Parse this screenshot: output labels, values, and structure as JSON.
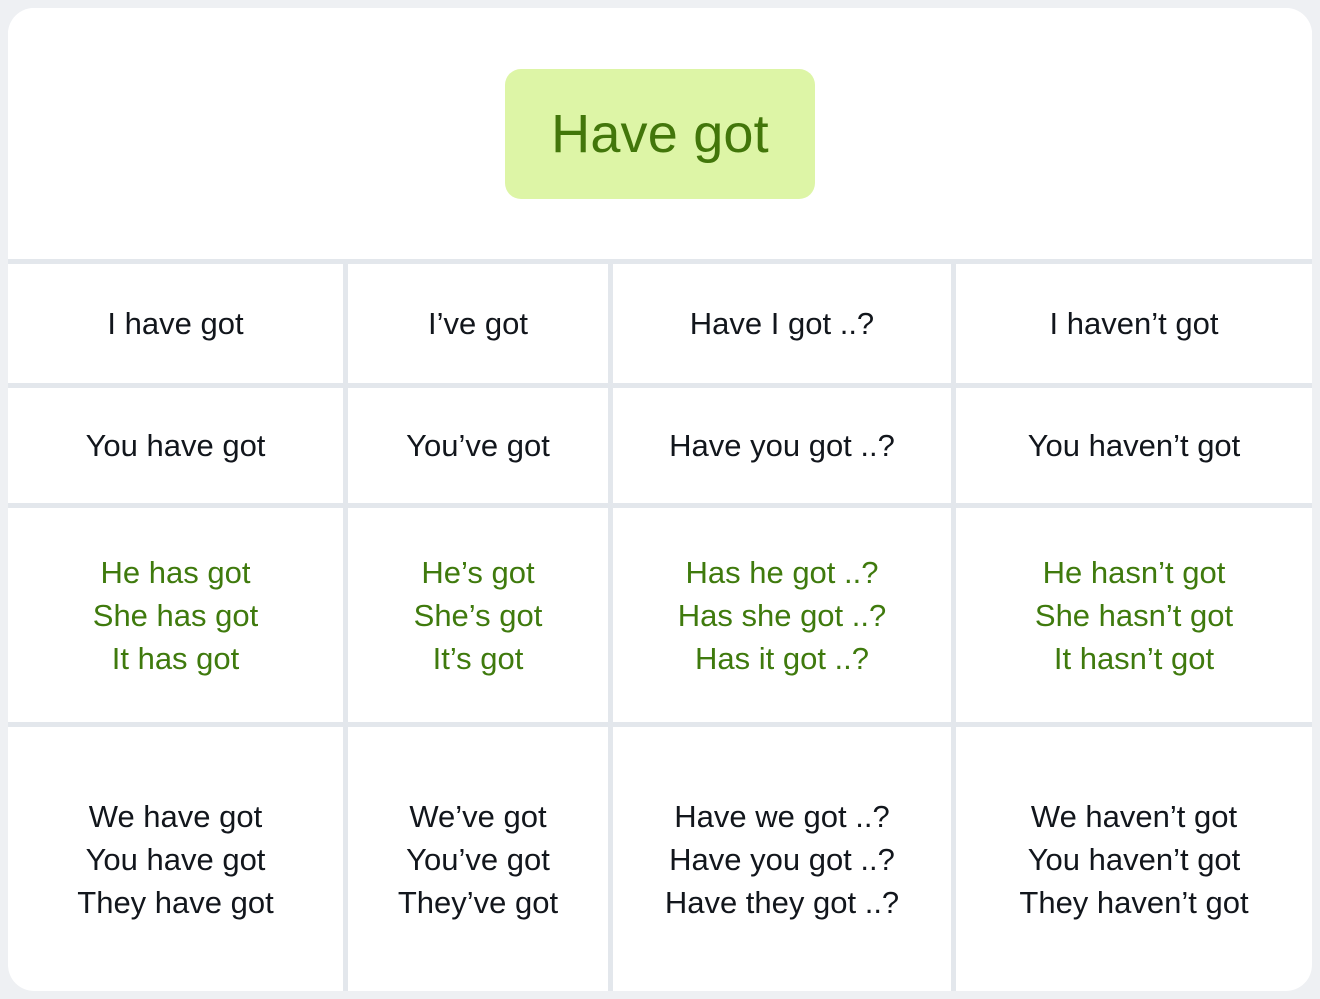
{
  "card": {
    "title": "Have got",
    "accent_green_text": "#42760a",
    "accent_green_badge_bg": "#ddf5a6",
    "grid_line_color": "#e3e7ec",
    "default_text_color": "#12161c",
    "page_bg": "#eef0f3"
  },
  "grid": {
    "rows": [
      {
        "id": "row-i",
        "highlight": false,
        "cells": [
          {
            "lines": [
              "I have got"
            ]
          },
          {
            "lines": [
              "I’ve got"
            ]
          },
          {
            "lines": [
              "Have I got ..?"
            ]
          },
          {
            "lines": [
              "I haven’t got"
            ]
          }
        ]
      },
      {
        "id": "row-you-singular",
        "highlight": false,
        "cells": [
          {
            "lines": [
              "You have got"
            ]
          },
          {
            "lines": [
              "You’ve got"
            ]
          },
          {
            "lines": [
              "Have you got ..?"
            ]
          },
          {
            "lines": [
              "You haven’t got"
            ]
          }
        ]
      },
      {
        "id": "row-third-person-singular",
        "highlight": true,
        "cells": [
          {
            "lines": [
              "He has got",
              "She has got",
              "It has got"
            ]
          },
          {
            "lines": [
              "He’s got",
              "She’s got",
              "It’s got"
            ]
          },
          {
            "lines": [
              "Has he got ..?",
              "Has she got ..?",
              "Has it got ..?"
            ]
          },
          {
            "lines": [
              "He hasn’t got",
              "She hasn’t got",
              "It hasn’t got"
            ]
          }
        ]
      },
      {
        "id": "row-plural",
        "highlight": false,
        "cells": [
          {
            "lines": [
              "We have got",
              "You have got",
              "They have got"
            ]
          },
          {
            "lines": [
              "We’ve got",
              "You’ve got",
              "They’ve got"
            ]
          },
          {
            "lines": [
              "Have we got ..?",
              "Have you got ..?",
              "Have they got ..?"
            ]
          },
          {
            "lines": [
              "We haven’t got",
              "You haven’t got",
              "They haven’t got"
            ]
          }
        ]
      }
    ]
  }
}
